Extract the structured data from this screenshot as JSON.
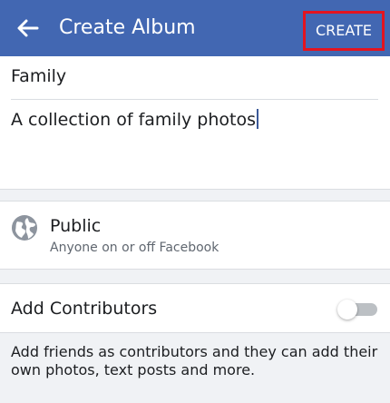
{
  "header": {
    "title": "Create Album",
    "create_label": "CREATE",
    "back_icon": "arrow-left-icon",
    "background_color": "#4267b2",
    "highlight_color": "#e3141f"
  },
  "form": {
    "name_value": "Family",
    "description_value": "A collection of family photos"
  },
  "privacy": {
    "icon": "globe-icon",
    "title": "Public",
    "subtitle": "Anyone on or off Facebook"
  },
  "contributors": {
    "label": "Add Contributors",
    "enabled": false,
    "help_text": "Add friends as contributors and they can add their own photos, text posts and more."
  }
}
